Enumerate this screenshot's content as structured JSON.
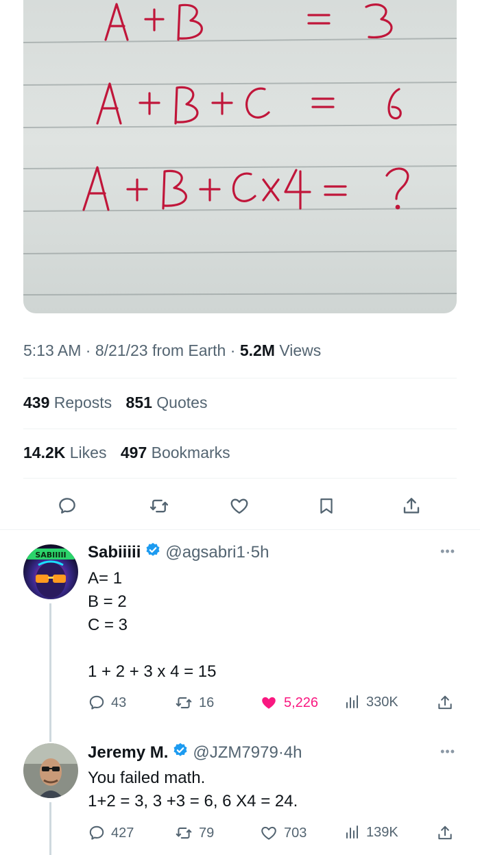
{
  "tweet": {
    "image": {
      "lines": [
        "A + B = 3",
        "A + B + C = 6",
        "A + B + C X 4 = ?"
      ]
    },
    "meta": {
      "time": "5:13 AM",
      "date": "8/21/23",
      "source": "from Earth",
      "views_count": "5.2M",
      "views_label": "Views"
    },
    "stats": {
      "reposts_count": "439",
      "reposts_label": "Reposts",
      "quotes_count": "851",
      "quotes_label": "Quotes",
      "likes_count": "14.2K",
      "likes_label": "Likes",
      "bookmarks_count": "497",
      "bookmarks_label": "Bookmarks"
    }
  },
  "replies": [
    {
      "name": "Sabiiiii",
      "handle": "@agsabri1",
      "time": "5h",
      "avatar_text": "SABIIIII",
      "body": [
        "A= 1",
        "B = 2",
        "C = 3",
        "",
        "1 + 2 + 3 x 4 = 15"
      ],
      "replies_count": "43",
      "reposts_count": "16",
      "likes_count": "5,226",
      "views_count": "330K",
      "liked": true
    },
    {
      "name": "Jeremy M.",
      "handle": "@JZM7979",
      "time": "4h",
      "body": [
        "You failed math.",
        "1+2 = 3, 3 +3 = 6, 6 X4 = 24."
      ],
      "replies_count": "427",
      "reposts_count": "79",
      "likes_count": "703",
      "views_count": "139K",
      "liked": false
    }
  ],
  "colors": {
    "verified": "#1d9bf0",
    "like_active": "#f91880",
    "secondary_text": "#536471",
    "ink": "#c0163a"
  }
}
